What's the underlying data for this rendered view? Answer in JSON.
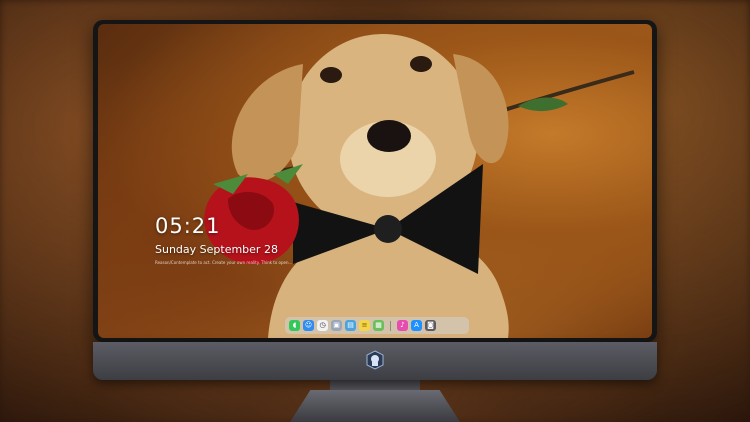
{
  "lockscreen": {
    "time": "05:21",
    "date": "Sunday September  28",
    "quote": "Reason/Contemplate to act. Create your own reality. Think to open..."
  },
  "dock": {
    "items": [
      {
        "name": "messages",
        "icon": "speech-bubble-icon",
        "color": "#34c759"
      },
      {
        "name": "finder",
        "icon": "face-icon",
        "color": "#2f8cf0"
      },
      {
        "name": "clock",
        "icon": "clock-icon",
        "color": "#f2f2f2"
      },
      {
        "name": "preview",
        "icon": "photo-icon",
        "color": "#9aa7b8"
      },
      {
        "name": "videos",
        "icon": "clapper-icon",
        "color": "#4aa3df"
      },
      {
        "name": "notes",
        "icon": "note-icon",
        "color": "#f5d547"
      },
      {
        "name": "photos",
        "icon": "image-icon",
        "color": "#6cbf5a"
      },
      {
        "name": "music",
        "icon": "music-icon",
        "color": "#e74cb0"
      },
      {
        "name": "app-store",
        "icon": "appstore-icon",
        "color": "#1e90ff"
      },
      {
        "name": "camera",
        "icon": "camera-icon",
        "color": "#5a5a60"
      }
    ]
  },
  "colors": {
    "monitor_bezel": "#151515",
    "monitor_chin": "#4a4a52",
    "wallpaper_accent": "#b06a24"
  }
}
